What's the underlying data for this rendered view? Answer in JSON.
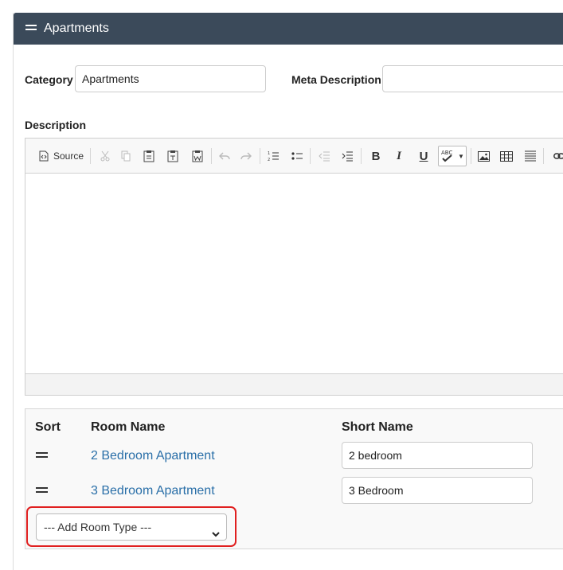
{
  "panel": {
    "title": "Apartments",
    "header_color": "#3b4a5a"
  },
  "form": {
    "category_label": "Category",
    "category_value": "Apartments",
    "meta_description_label": "Meta Description",
    "meta_description_value": "",
    "description_label": "Description"
  },
  "editor": {
    "toolbar": {
      "source_label": "Source",
      "icons": [
        "source-icon",
        "cut-icon",
        "copy-icon",
        "paste-icon",
        "paste-text-icon",
        "paste-word-icon",
        "undo-icon",
        "redo-icon",
        "numbered-list-icon",
        "bulleted-list-icon",
        "decrease-indent-icon",
        "increase-indent-icon",
        "bold-icon",
        "italic-icon",
        "underline-icon",
        "spellcheck-icon",
        "image-icon",
        "table-icon",
        "horizontal-line-icon",
        "link-icon"
      ],
      "bold": "B",
      "italic": "I",
      "underline": "U",
      "spell": "ABC"
    }
  },
  "rooms": {
    "columns": {
      "sort": "Sort",
      "room_name": "Room Name",
      "short_name": "Short Name"
    },
    "rows": [
      {
        "room_name": "2 Bedroom Apartment",
        "short_name": "2 bedroom"
      },
      {
        "room_name": "3 Bedroom Apartment",
        "short_name": "3 Bedroom"
      }
    ],
    "add_select": "--- Add Room Type ---",
    "link_color": "#2a6fa8",
    "highlight_color": "#e02020"
  }
}
